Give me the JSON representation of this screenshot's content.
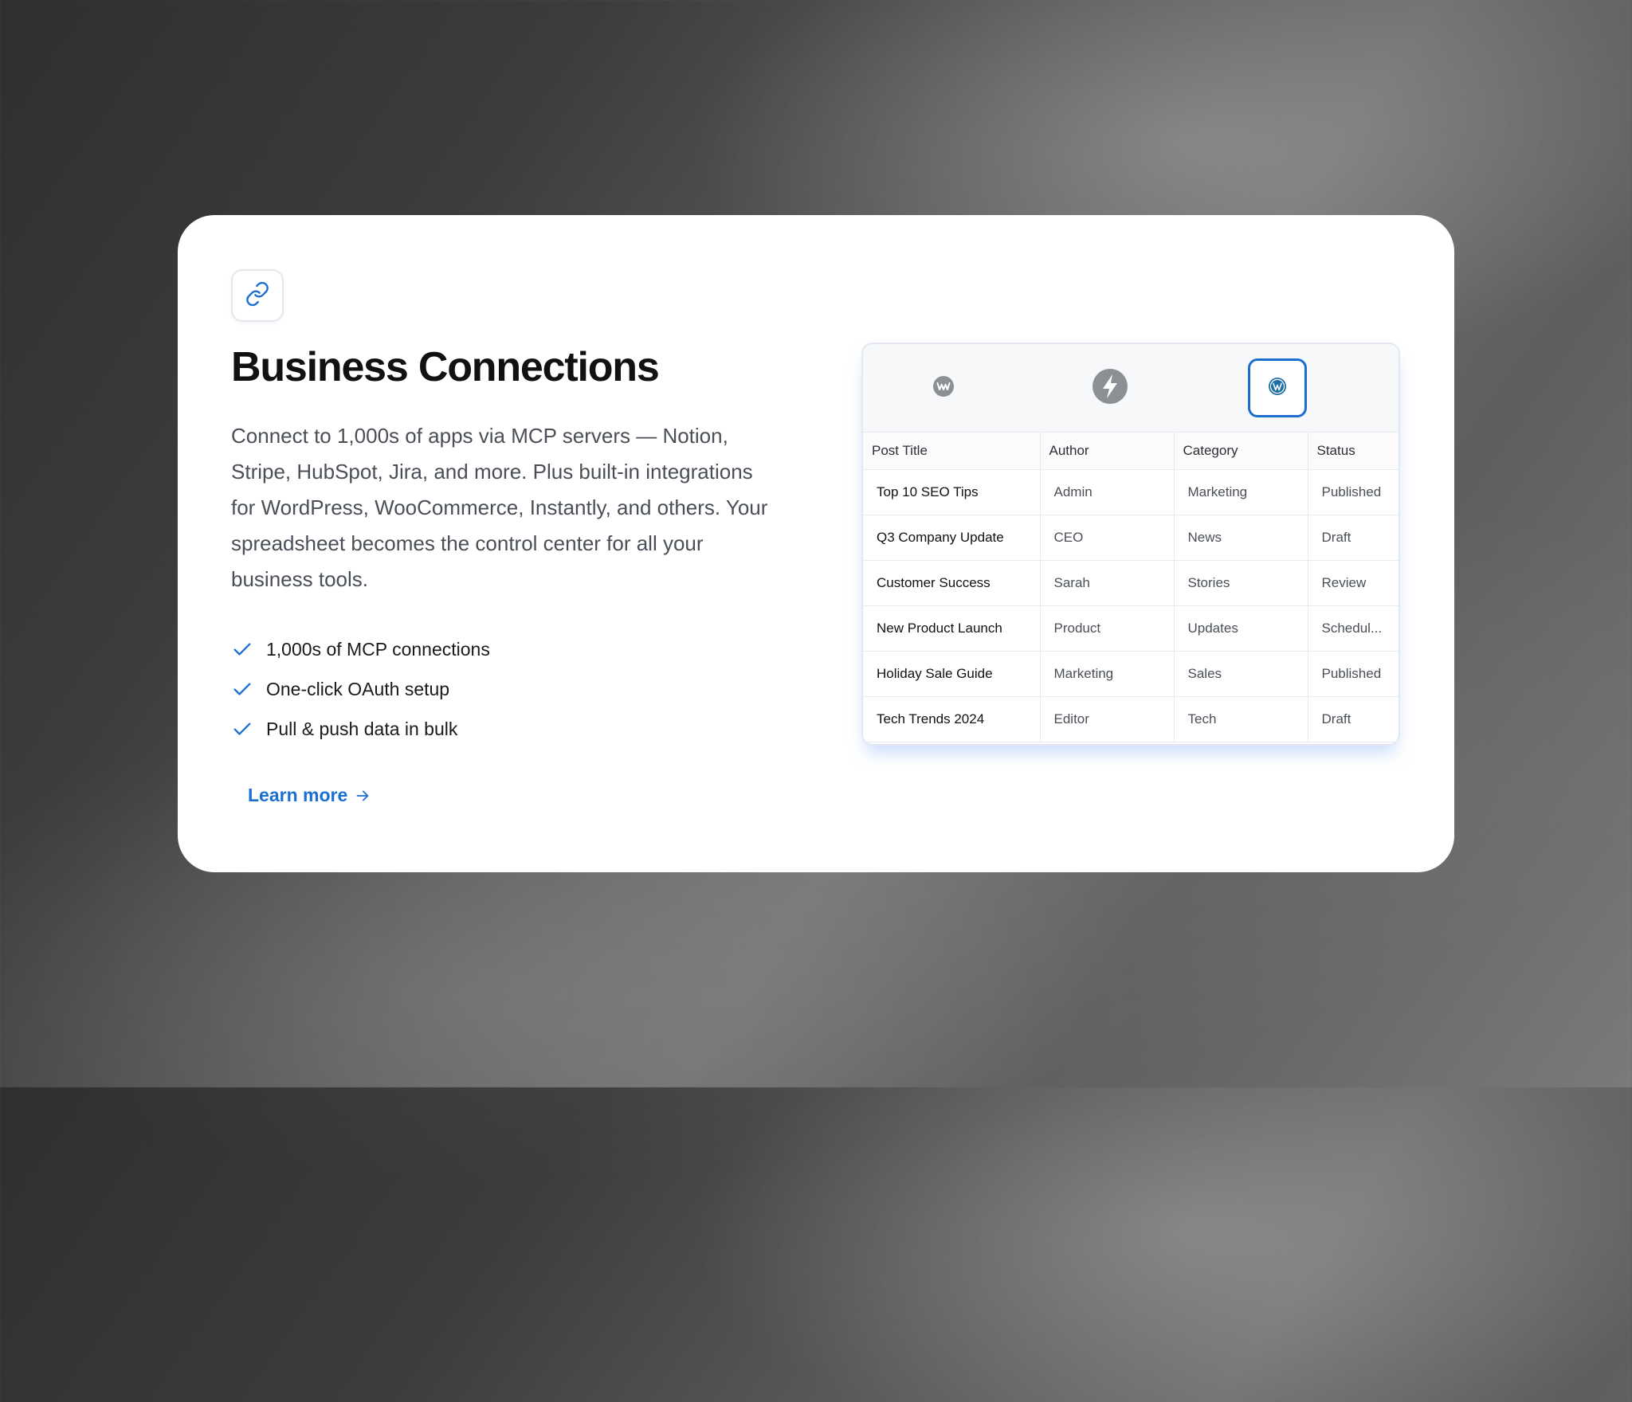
{
  "feature": {
    "icon": "link-icon",
    "title": "Business Connections",
    "description": "Connect to 1,000s of apps via MCP servers — Notion, Stripe, HubSpot, Jira, and more. Plus built-in integrations for WordPress, WooCommerce, Instantly, and others. Your spreadsheet becomes the control center for all your business tools.",
    "bullets": [
      "1,000s of MCP connections",
      "One-click OAuth setup",
      "Pull & push data in bulk"
    ],
    "learn_more": "Learn more",
    "accent_color": "#1a6fd1"
  },
  "tools": [
    {
      "icon": "woocommerce-icon",
      "selected": false
    },
    {
      "icon": "instantly-bolt-icon",
      "selected": false
    },
    {
      "icon": "wordpress-icon",
      "selected": true
    }
  ],
  "table": {
    "headers": [
      "Post Title",
      "Author",
      "Category",
      "Status"
    ],
    "rows": [
      [
        "Top 10 SEO Tips",
        "Admin",
        "Marketing",
        "Published"
      ],
      [
        "Q3 Company Update",
        "CEO",
        "News",
        "Draft"
      ],
      [
        "Customer Success",
        "Sarah",
        "Stories",
        "Review"
      ],
      [
        "New Product Launch",
        "Product",
        "Updates",
        "Schedul..."
      ],
      [
        "Holiday Sale Guide",
        "Marketing",
        "Sales",
        "Published"
      ],
      [
        "Tech Trends 2024",
        "Editor",
        "Tech",
        "Draft"
      ]
    ]
  }
}
